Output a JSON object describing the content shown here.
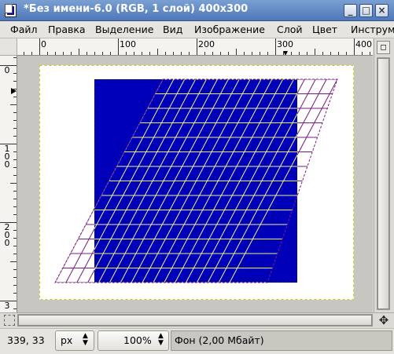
{
  "window": {
    "title": "*Без имени-6.0 (RGB, 1 слой) 400x300",
    "controls": {
      "minimize": "_",
      "maximize": "□",
      "close": "×"
    }
  },
  "menubar": {
    "items": [
      {
        "label": "Файл"
      },
      {
        "label": "Правка"
      },
      {
        "label": "Выделение"
      },
      {
        "label": "Вид"
      },
      {
        "label": "Изображение"
      },
      {
        "label": "Слой"
      },
      {
        "label": "Цвет"
      },
      {
        "label": "Инструм"
      }
    ]
  },
  "rulers": {
    "horizontal_labels": [
      "0",
      "100",
      "200",
      "300",
      "400"
    ],
    "vertical_labels": [
      "0",
      "100",
      "200",
      "3"
    ]
  },
  "canvas": {
    "image_size": "400x300",
    "colors": {
      "page_background": "#ffffff",
      "fill": "#0000b8",
      "grid": "#f1f18a",
      "transform_preview": "#7a1a8a",
      "boundary": "#cccc00"
    }
  },
  "statusbar": {
    "coordinates": "339, 33",
    "unit": "px",
    "zoom": "100%",
    "info": "Фон (2,00 Мбайт)"
  },
  "icons": {
    "app": "gimp-image-icon",
    "navigate": "navigate-cross-icon",
    "quick_mask": "quick-mask-icon",
    "menu_arrow": "ruler-menu-arrow-icon"
  }
}
